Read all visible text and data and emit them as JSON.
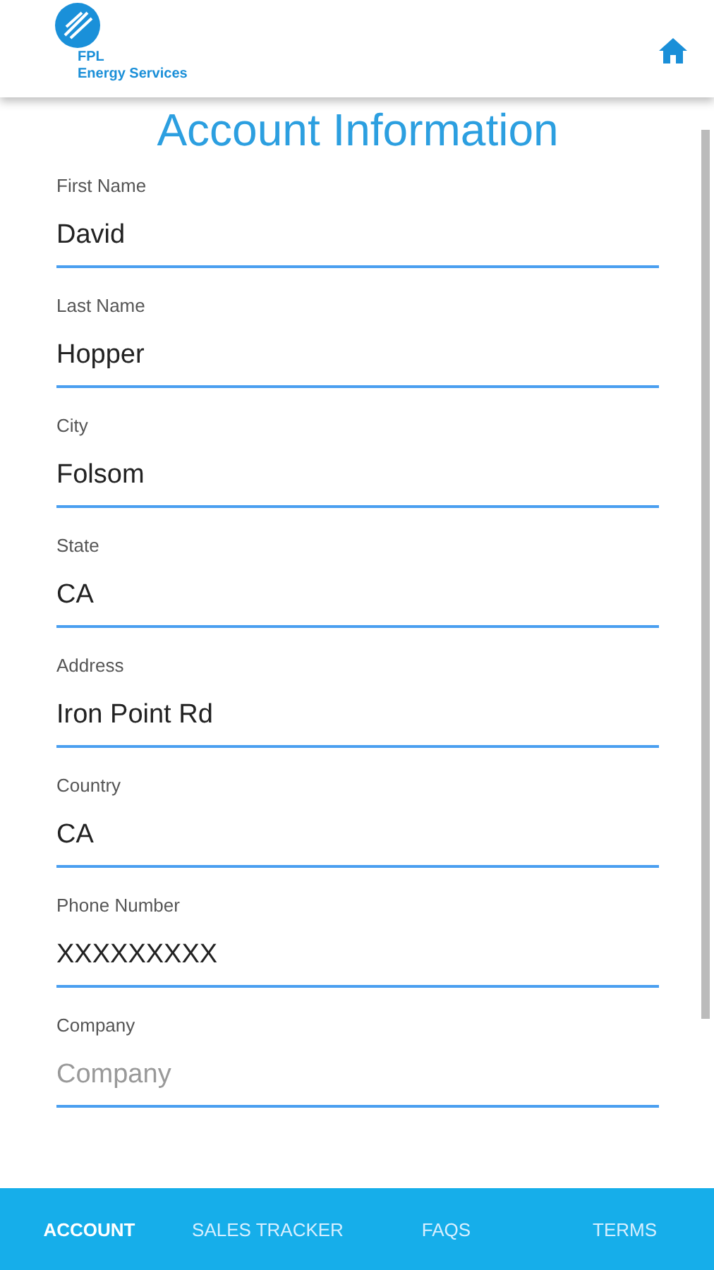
{
  "header": {
    "logo_line_1": "FPL",
    "logo_line_2": "Energy Services"
  },
  "title": "Account Information",
  "fields": [
    {
      "label": "First Name",
      "value": "David"
    },
    {
      "label": "Last Name",
      "value": "Hopper"
    },
    {
      "label": "City",
      "value": "Folsom"
    },
    {
      "label": "State",
      "value": "CA"
    },
    {
      "label": "Address",
      "value": "Iron Point Rd"
    },
    {
      "label": "Country",
      "value": "CA"
    },
    {
      "label": "Phone Number",
      "value": "XXXXXXXXX"
    },
    {
      "label": "Company",
      "placeholder": "Company"
    }
  ],
  "nav": [
    {
      "label": "ACCOUNT",
      "selected": true
    },
    {
      "label": "SALES TRACKER",
      "selected": false
    },
    {
      "label": "FAQS",
      "selected": false
    },
    {
      "label": "TERMS",
      "selected": false
    }
  ]
}
